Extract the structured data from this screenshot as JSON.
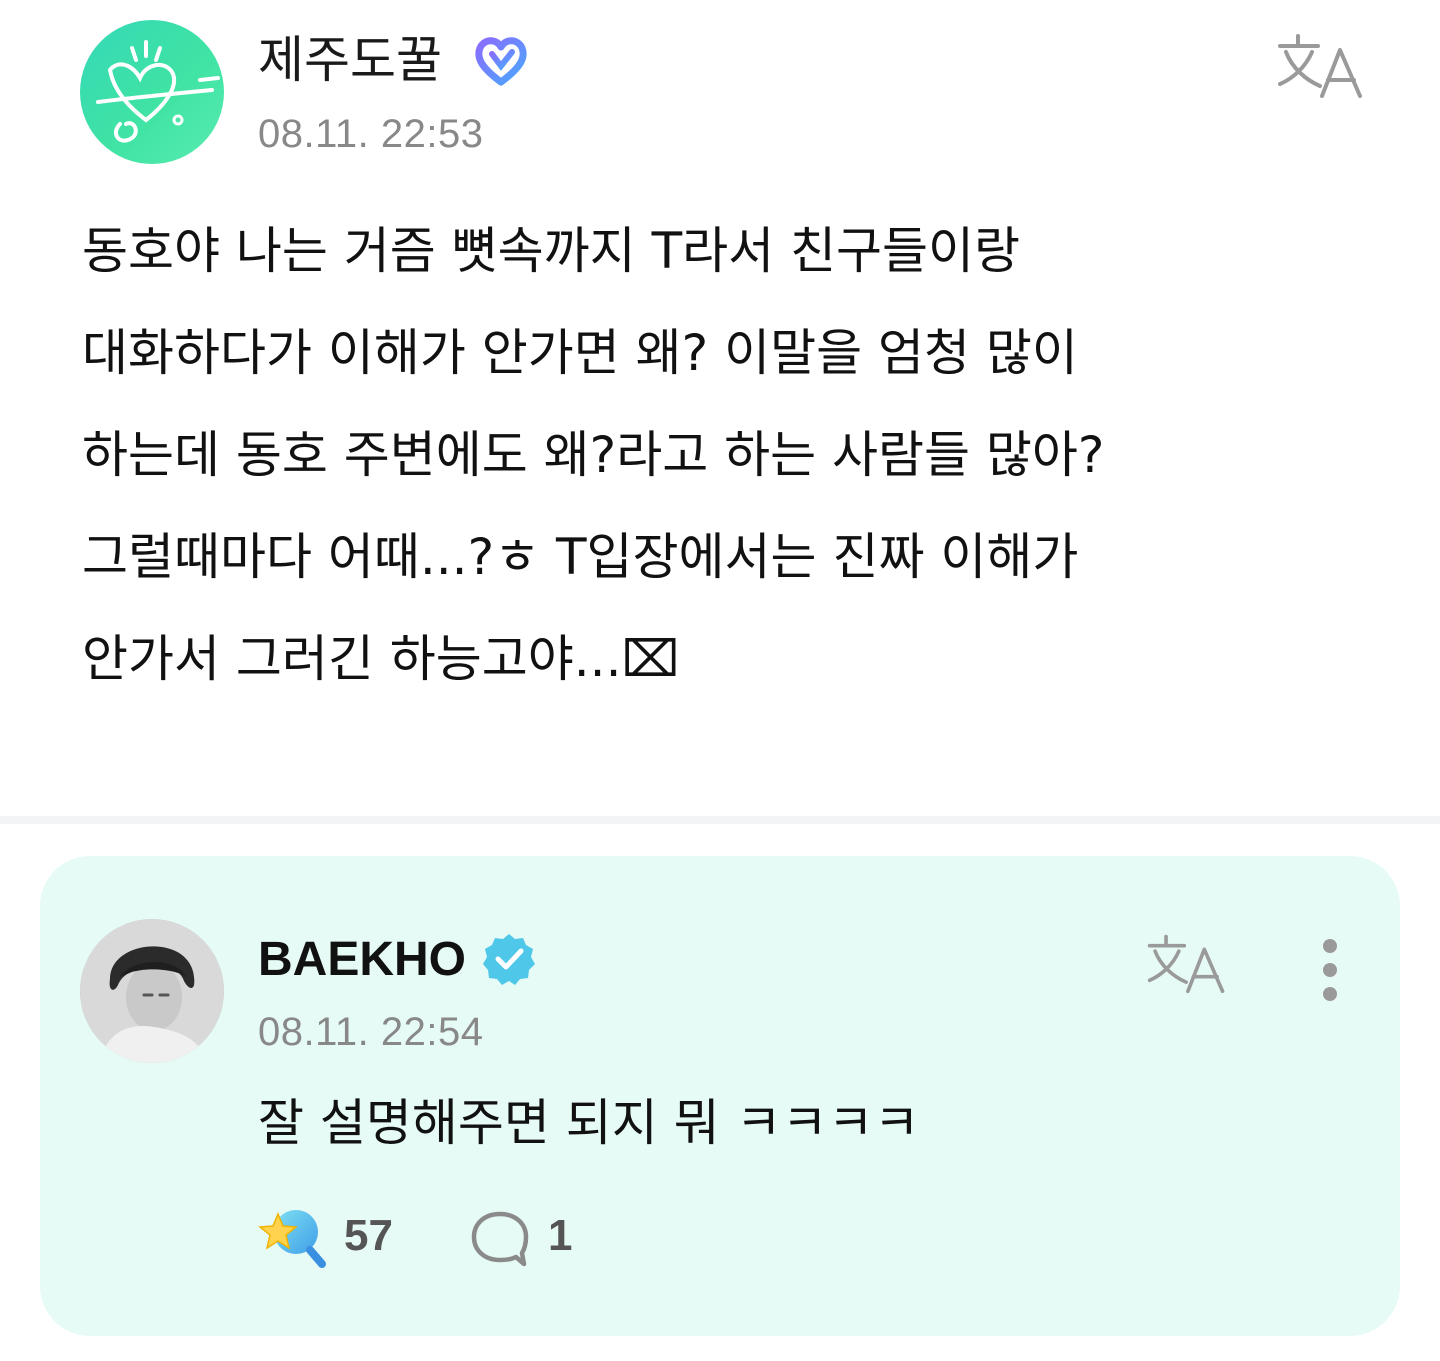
{
  "post": {
    "author_name": "제주도꿀",
    "badge_icon": "fan-heart-badge-icon",
    "timestamp": "08.11. 22:53",
    "translate_icon": "translate-icon",
    "body": "동호야 나는 거즘 뼛속까지 T라서 친구들이랑\n대화하다가 이해가 안가면 왜? 이말을 엄청 많이\n하는데 동호 주변에도 왜?라고 하는 사람들 많아?\n그럴때마다 어때...?ㅎ T입장에서는 진짜 이해가\n안가서 그러긴 하능고야...⌧"
  },
  "reply": {
    "author_name": "BAEKHO",
    "badge_icon": "verified-icon",
    "timestamp": "08.11. 22:54",
    "translate_icon": "translate-icon",
    "more_icon": "more-vertical-icon",
    "body": "잘 설명해주면 되지 뭐 ㅋㅋㅋㅋ",
    "like_count": "57",
    "comment_count": "1"
  },
  "colors": {
    "card_background": "#e6fbf6",
    "fan_avatar": "#3fe3a3",
    "verified": "#4fc7e8",
    "fan_badge_gradient": [
      "#8a6cff",
      "#4aa8ff"
    ],
    "muted_text": "#888888"
  }
}
